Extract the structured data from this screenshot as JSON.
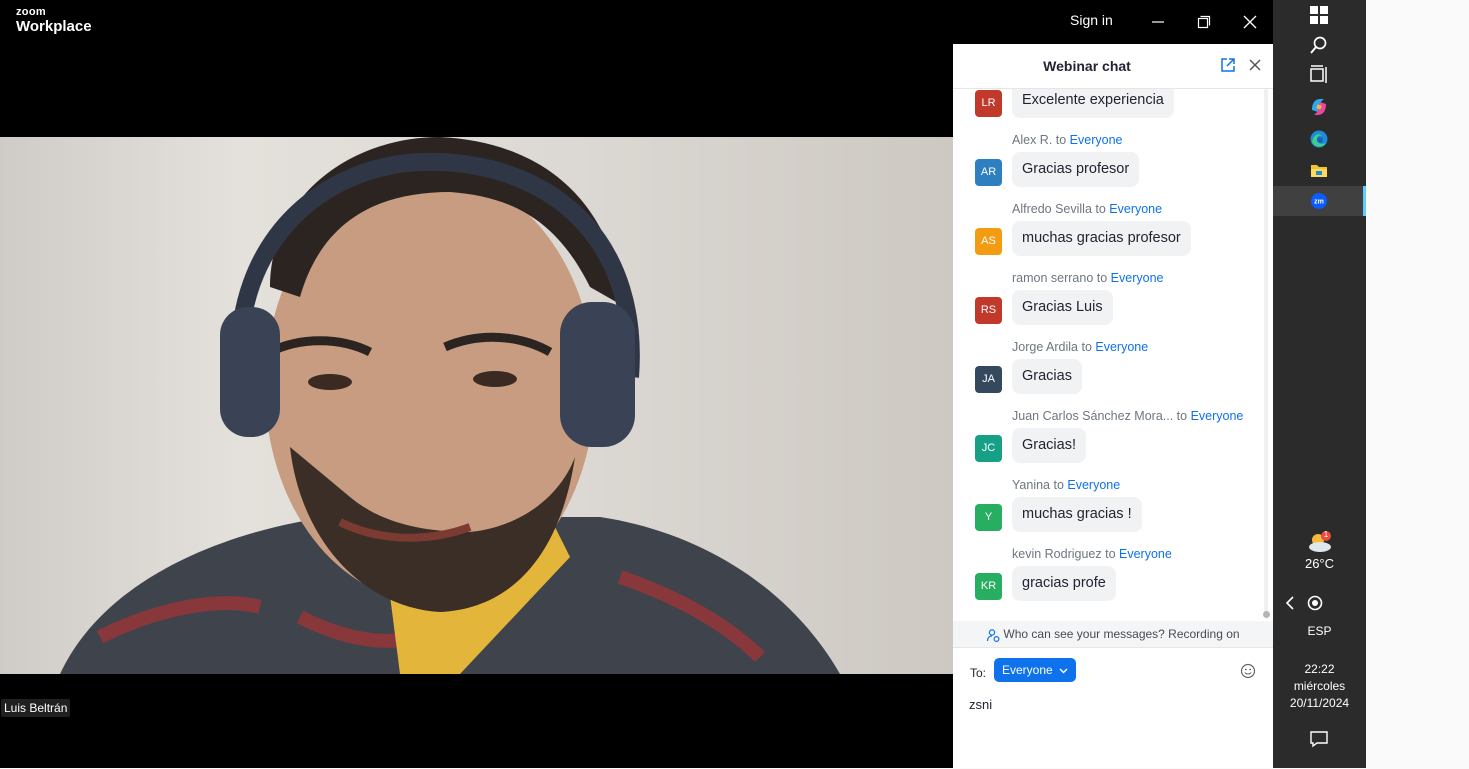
{
  "titlebar": {
    "logo_top": "zoom",
    "logo_bottom": "Workplace",
    "sign_in": "Sign in"
  },
  "video": {
    "participant_name": "Luis Beltrán"
  },
  "chat": {
    "title": "Webinar chat",
    "messages": [
      {
        "sender": "",
        "to": "",
        "initials": "LR",
        "text": "Excelente experiencia",
        "avatar_color": "#c0392b"
      },
      {
        "sender": "Alex R.",
        "to": "Everyone",
        "initials": "AR",
        "text": "Gracias profesor",
        "avatar_color": "#2e7fbf"
      },
      {
        "sender": "Alfredo Sevilla",
        "to": "Everyone",
        "initials": "AS",
        "text": "muchas gracias profesor",
        "avatar_color": "#f39c12"
      },
      {
        "sender": "ramon serrano",
        "to": "Everyone",
        "initials": "RS",
        "text": "Gracias Luis",
        "avatar_color": "#c0392b"
      },
      {
        "sender": "Jorge Ardila",
        "to": "Everyone",
        "initials": "JA",
        "text": "Gracias",
        "avatar_color": "#34495e"
      },
      {
        "sender": "Juan Carlos Sánchez Mora...",
        "to": "Everyone",
        "initials": "JC",
        "text": "Gracias!",
        "avatar_color": "#16a085"
      },
      {
        "sender": "Yanina",
        "to": "Everyone",
        "initials": "Y",
        "text": "muchas gracias !",
        "avatar_color": "#27ae60"
      },
      {
        "sender": "kevin Rodriguez",
        "to": "Everyone",
        "initials": "KR",
        "text": "gracias profe",
        "avatar_color": "#27ae60"
      }
    ],
    "visibility_notice": "Who can see your messages? Recording on",
    "to_label": "To:",
    "recipient": "Everyone",
    "input_value": "zsni"
  },
  "taskbar": {
    "weather_temp": "26°C",
    "weather_badge": "1",
    "language": "ESP",
    "time": "22:22",
    "weekday": "miércoles",
    "date": "20/11/2024"
  },
  "colors": {
    "zoom_blue": "#0e72ed",
    "taskbar_bg": "#2b2b2b",
    "active_indicator": "#60cdff"
  }
}
